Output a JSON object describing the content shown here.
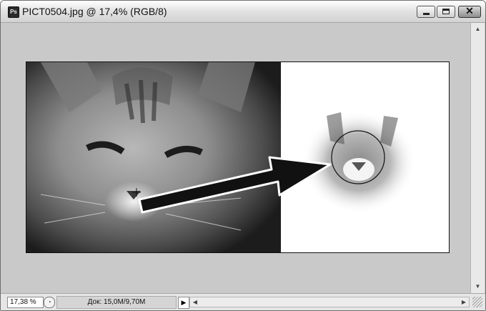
{
  "window": {
    "title": "PICT0504.jpg @ 17,4% (RGB/8)",
    "app_icon_label": "Ps",
    "buttons": {
      "minimize": "minimize-icon",
      "maximize": "maximize-icon",
      "close": "✕"
    }
  },
  "status": {
    "zoom": "17,38 %",
    "doc_info": "Док: 15,0M/9,70M",
    "menu_arrow": "▶"
  },
  "scroll": {
    "up": "▲",
    "down": "▼",
    "left": "◀",
    "right": "▶"
  },
  "colors": {
    "canvas_bg": "#c9c9c9",
    "window_chrome": "#e4e4e4",
    "arrow": "#111111"
  }
}
